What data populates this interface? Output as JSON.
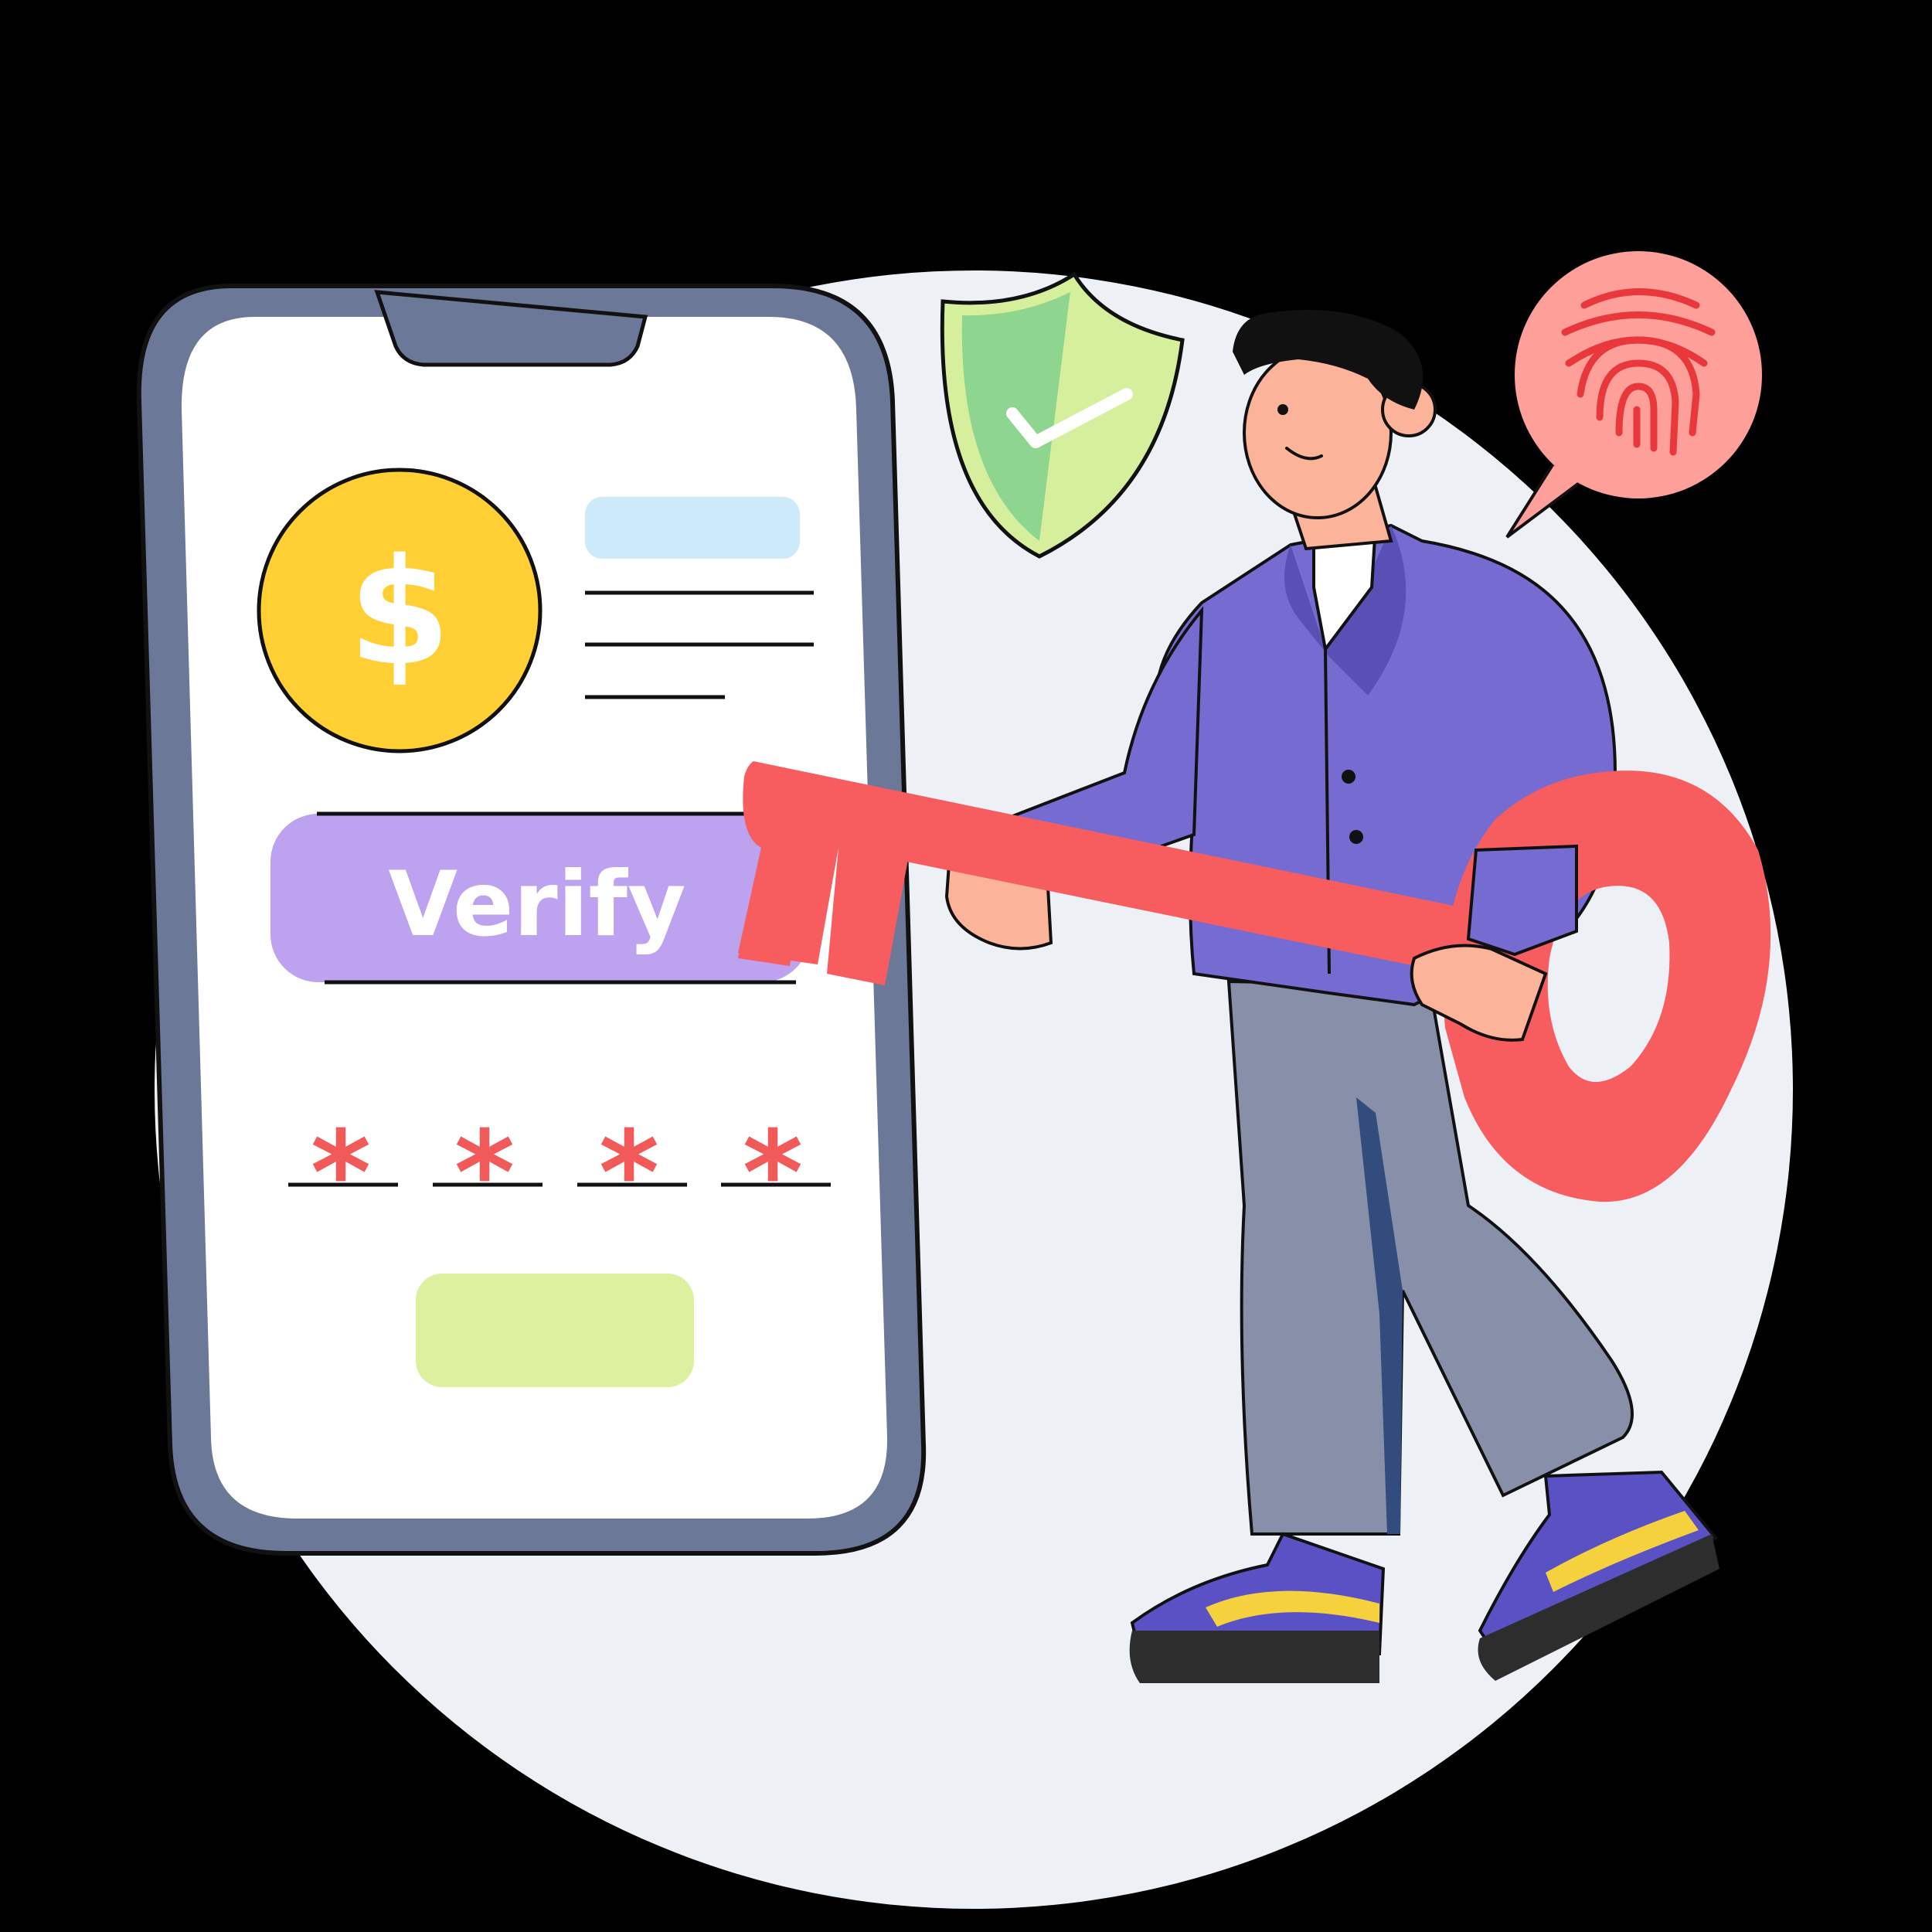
{
  "colors": {
    "background": "#000000",
    "backdrop_circle": "#edf1f6",
    "phone_frame": "#6b7898",
    "phone_screen": "#ffffff",
    "coin": "#ffcf33",
    "verify_button": "#bda2ef",
    "pin_asterisk": "#f25a5a",
    "submit_button": "#dcf0a0",
    "placeholder_bar": "#cdeafb",
    "shield_left": "#8ed68f",
    "shield_right": "#d6ef9c",
    "fingerprint_bubble": "#ff9f9a",
    "fingerprint_lines": "#e8383c",
    "key": "#f75d5f",
    "jacket": "#766bd1",
    "trousers": "#8790a8",
    "shoes": "#5a52c4",
    "shoe_stripe": "#f5d13e"
  },
  "phone": {
    "coin_symbol": "$",
    "verify_label": "Verify",
    "pin_mask": [
      "*",
      "*",
      "*",
      "*"
    ]
  },
  "icons": {
    "coin": "dollar-coin-icon",
    "shield": "shield-check-icon",
    "fingerprint": "fingerprint-icon",
    "key": "key-icon"
  }
}
